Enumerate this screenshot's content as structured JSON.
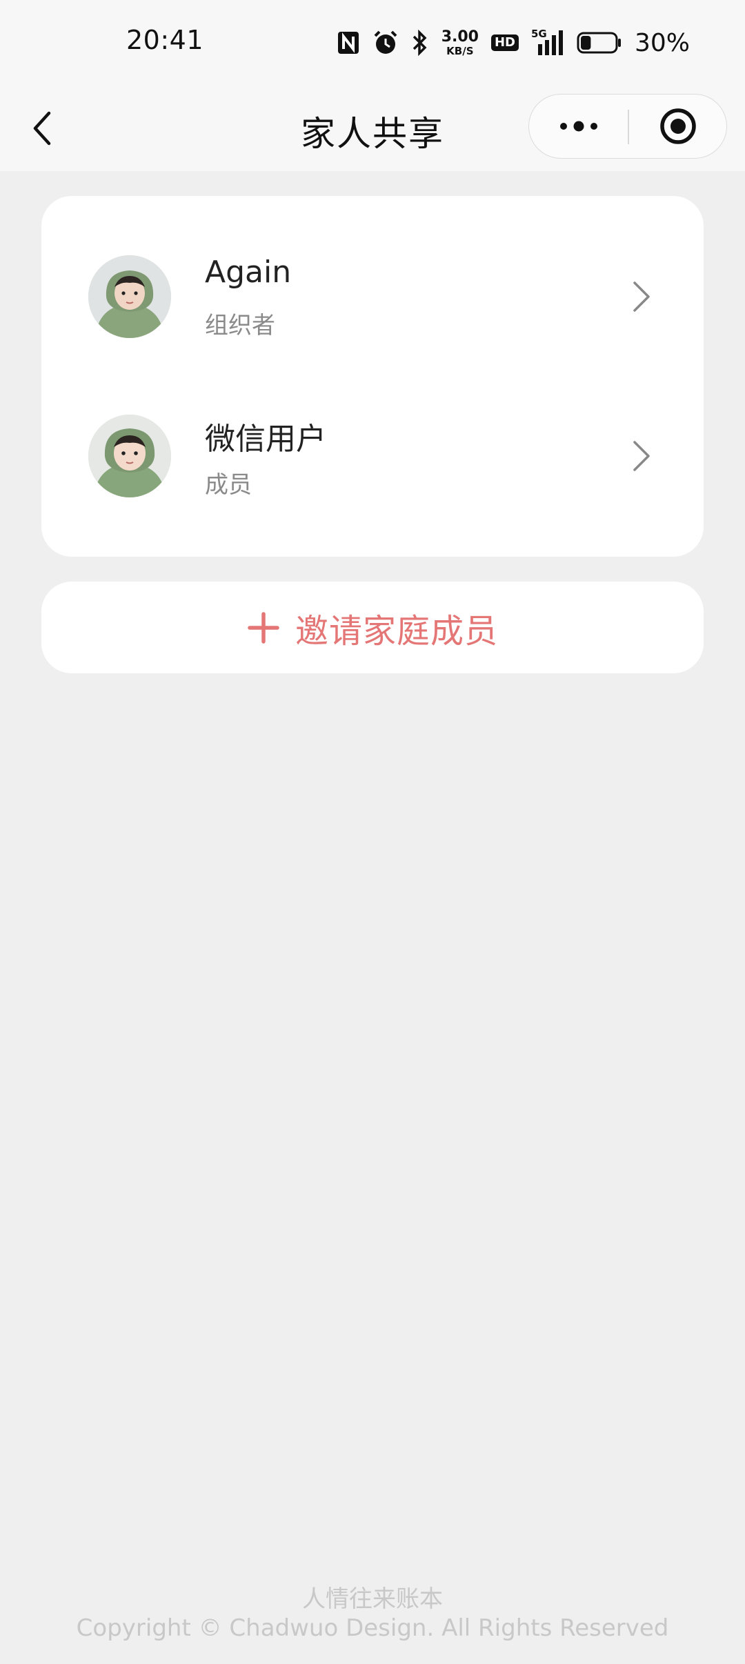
{
  "status_bar": {
    "time": "20:41",
    "net_speed_value": "3.00",
    "net_speed_unit": "KB/S",
    "hd_label": "HD",
    "network_label": "5G",
    "battery_level_percent": 30,
    "battery_text": "30%",
    "icons": [
      "nfc-icon",
      "alarm-icon",
      "bluetooth-icon",
      "signal-icon",
      "battery-icon"
    ]
  },
  "nav": {
    "title": "家人共享",
    "back_icon": "chevron-left-icon",
    "more_icon": "more-dots-icon",
    "close_icon": "target-circle-icon"
  },
  "members": [
    {
      "name": "Again",
      "role": "组织者"
    },
    {
      "name": "微信用户",
      "role": "成员"
    }
  ],
  "invite": {
    "label": "邀请家庭成员",
    "icon": "plus-icon",
    "color": "#e47676"
  },
  "footer": {
    "app_name": "人情往来账本",
    "copyright": "Copyright © Chadwuo Design. All Rights Reserved"
  }
}
